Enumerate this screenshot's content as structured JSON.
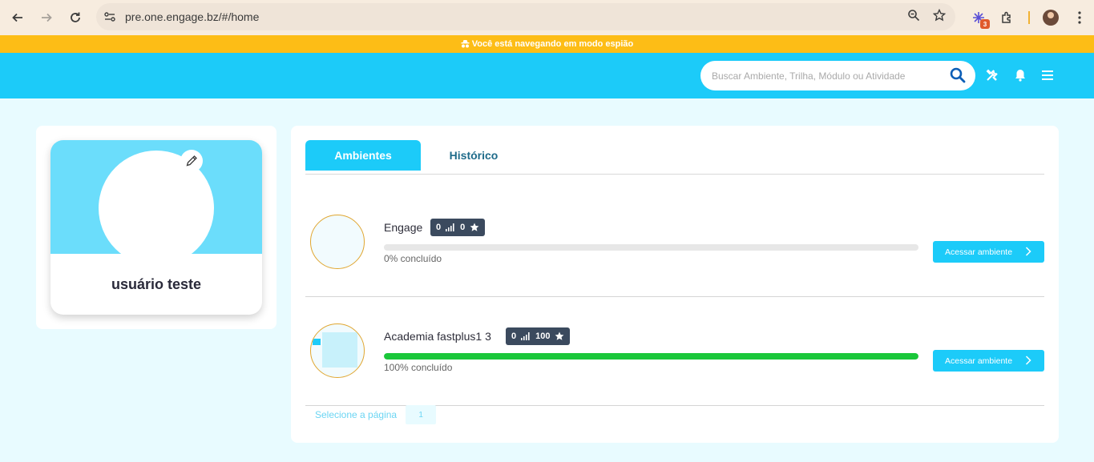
{
  "browser": {
    "url": "pre.one.engage.bz/#/home",
    "extension_badge": "3"
  },
  "spy_banner": {
    "text": "Você está navegando em modo espião"
  },
  "header": {
    "search_placeholder": "Buscar Ambiente, Trilha, Módulo ou Atividade"
  },
  "profile": {
    "name": "usuário teste"
  },
  "tabs": [
    {
      "label": "Ambientes",
      "active": true
    },
    {
      "label": "Histórico",
      "active": false
    }
  ],
  "environments": [
    {
      "name": "Engage",
      "stat_level": "0",
      "stat_stars": "0",
      "progress_percent": 0,
      "progress_text": "0% concluído",
      "button_label": "Acessar ambiente"
    },
    {
      "name": "Academia fastplus1 3",
      "stat_level": "0",
      "stat_stars": "100",
      "progress_percent": 100,
      "progress_text": "100% concluído",
      "button_label": "Acessar ambiente"
    }
  ],
  "pager": {
    "label": "Selecione a página",
    "current_page": "1"
  },
  "colors": {
    "accent": "#1ccbf9",
    "banner": "#fdbd16",
    "progress": "#1ac73a",
    "stats_badge": "#3b4a5e"
  }
}
